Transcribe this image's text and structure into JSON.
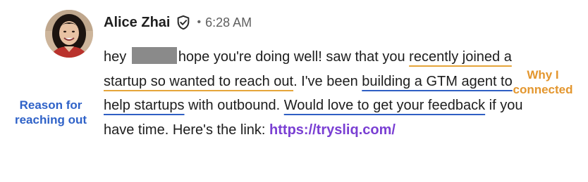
{
  "message": {
    "sender_name": "Alice Zhai",
    "separator": "•",
    "timestamp": "6:28 AM",
    "text": {
      "t1": "hey ",
      "t2": "hope you're doing well! saw that you ",
      "t3": "recently joined a startup so wanted to reach out",
      "t4": ". I've been ",
      "t5": "building a GTM agent to help startups",
      "t6": " with outbound. ",
      "t7": "Would love to get your feedback",
      "t8": " if you have time. Here's the link: ",
      "link": "https://trysliq.com/"
    }
  },
  "annotations": {
    "why": "Why I connected",
    "reason": "Reason for reaching out"
  },
  "icons": {
    "verified": "verified-shield-check-icon",
    "avatar": "profile-photo"
  },
  "colors": {
    "annotation_orange": "#e3962e",
    "annotation_blue": "#2f62c8",
    "link_purple": "#7a3fd3"
  }
}
